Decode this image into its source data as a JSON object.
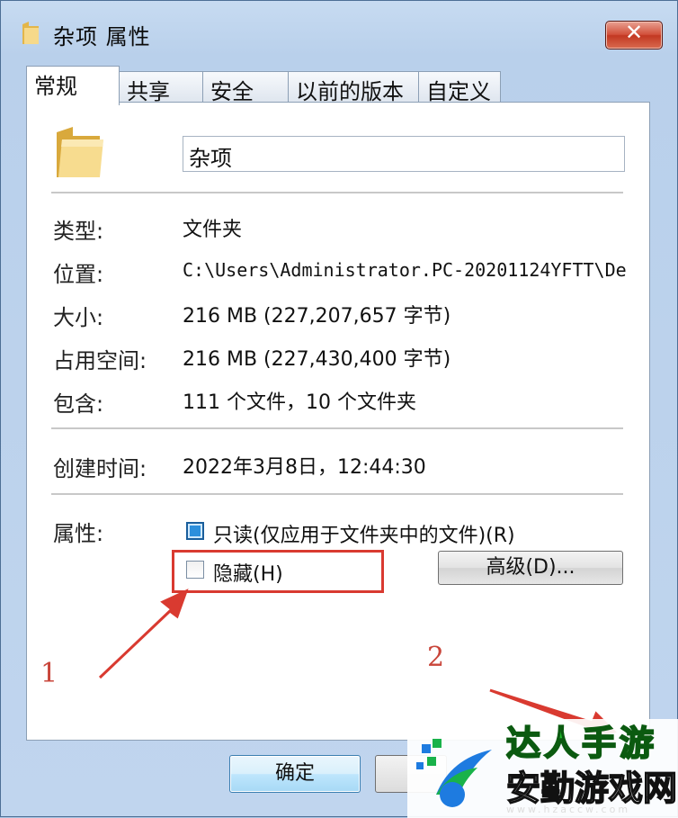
{
  "window": {
    "title": "杂项 属性",
    "close_icon": "close-icon"
  },
  "tabs": [
    {
      "label": "常规",
      "active": true
    },
    {
      "label": "共享",
      "active": false
    },
    {
      "label": "安全",
      "active": false
    },
    {
      "label": "以前的版本",
      "active": false
    },
    {
      "label": "自定义",
      "active": false
    }
  ],
  "general": {
    "folder_name": "杂项",
    "rows": [
      {
        "label": "类型:",
        "value": "文件夹"
      },
      {
        "label": "位置:",
        "value": "C:\\Users\\Administrator.PC-20201124YFTT\\De"
      },
      {
        "label": "大小:",
        "value": "216 MB (227,207,657 字节)"
      },
      {
        "label": "占用空间:",
        "value": "216 MB (227,430,400 字节)"
      },
      {
        "label": "包含:",
        "value": "111 个文件，10 个文件夹"
      }
    ],
    "created_label": "创建时间:",
    "created_value": "2022年3月8日，12:44:30",
    "attributes_label": "属性:",
    "readonly_label": "只读(仅应用于文件夹中的文件)(R)",
    "readonly_checked": true,
    "hidden_label": "隐藏(H)",
    "hidden_checked": false,
    "advanced_button": "高级(D)..."
  },
  "footer": {
    "ok_button": "确定"
  },
  "annotations": {
    "num1": "1",
    "num2": "2",
    "color": "#d93a30"
  },
  "watermark": {
    "line1": "达人手游",
    "line2": "安勤游戏网",
    "url": "www.hzaccw.com"
  }
}
